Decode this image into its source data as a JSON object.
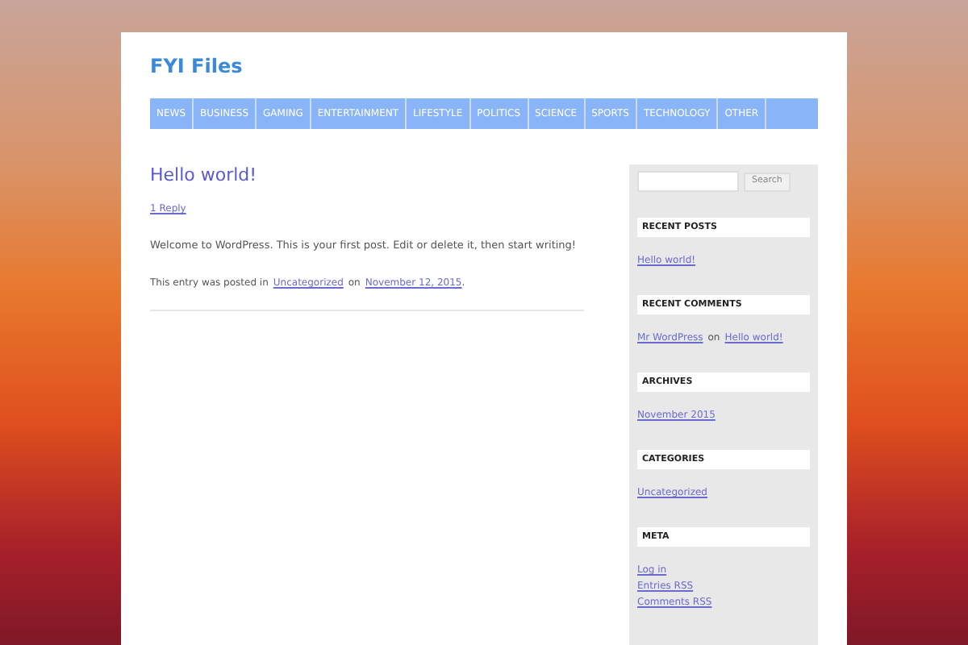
{
  "site": {
    "title": "FYI Files"
  },
  "nav": [
    {
      "label": "NEWS"
    },
    {
      "label": "BUSINESS"
    },
    {
      "label": "GAMING"
    },
    {
      "label": "ENTERTAINMENT"
    },
    {
      "label": "LIFESTYLE"
    },
    {
      "label": "POLITICS"
    },
    {
      "label": "SCIENCE"
    },
    {
      "label": "SPORTS"
    },
    {
      "label": "TECHNOLOGY"
    },
    {
      "label": "OTHER"
    }
  ],
  "post": {
    "title": "Hello world!",
    "replies": "1 Reply",
    "body": "Welcome to WordPress. This is your first post. Edit or delete it, then start writing!",
    "footer": [
      {
        "kind": "text",
        "text": "This entry was posted in"
      },
      {
        "kind": "link",
        "text": "Uncategorized"
      },
      {
        "kind": "text",
        "text": "on"
      },
      {
        "kind": "link",
        "text": "November 12, 2015"
      },
      {
        "kind": "text",
        "text": "."
      }
    ]
  },
  "sidebar": {
    "search_button": "Search",
    "widgets": [
      {
        "title": "RECENT POSTS",
        "items": [
          [
            {
              "kind": "link",
              "text": "Hello world!"
            }
          ]
        ]
      },
      {
        "title": "RECENT COMMENTS",
        "items": [
          [
            {
              "kind": "link",
              "text": "Mr WordPress"
            },
            {
              "kind": "text",
              "text": "on"
            },
            {
              "kind": "link",
              "text": "Hello world!"
            }
          ]
        ]
      },
      {
        "title": "ARCHIVES",
        "items": [
          [
            {
              "kind": "link",
              "text": "November 2015"
            }
          ]
        ]
      },
      {
        "title": "CATEGORIES",
        "items": [
          [
            {
              "kind": "link",
              "text": "Uncategorized"
            }
          ]
        ]
      },
      {
        "title": "META",
        "items": [
          [
            {
              "kind": "link",
              "text": "Log in"
            }
          ],
          [
            {
              "kind": "link",
              "text": "Entries RSS"
            }
          ],
          [
            {
              "kind": "link",
              "text": "Comments RSS"
            }
          ]
        ]
      }
    ]
  }
}
